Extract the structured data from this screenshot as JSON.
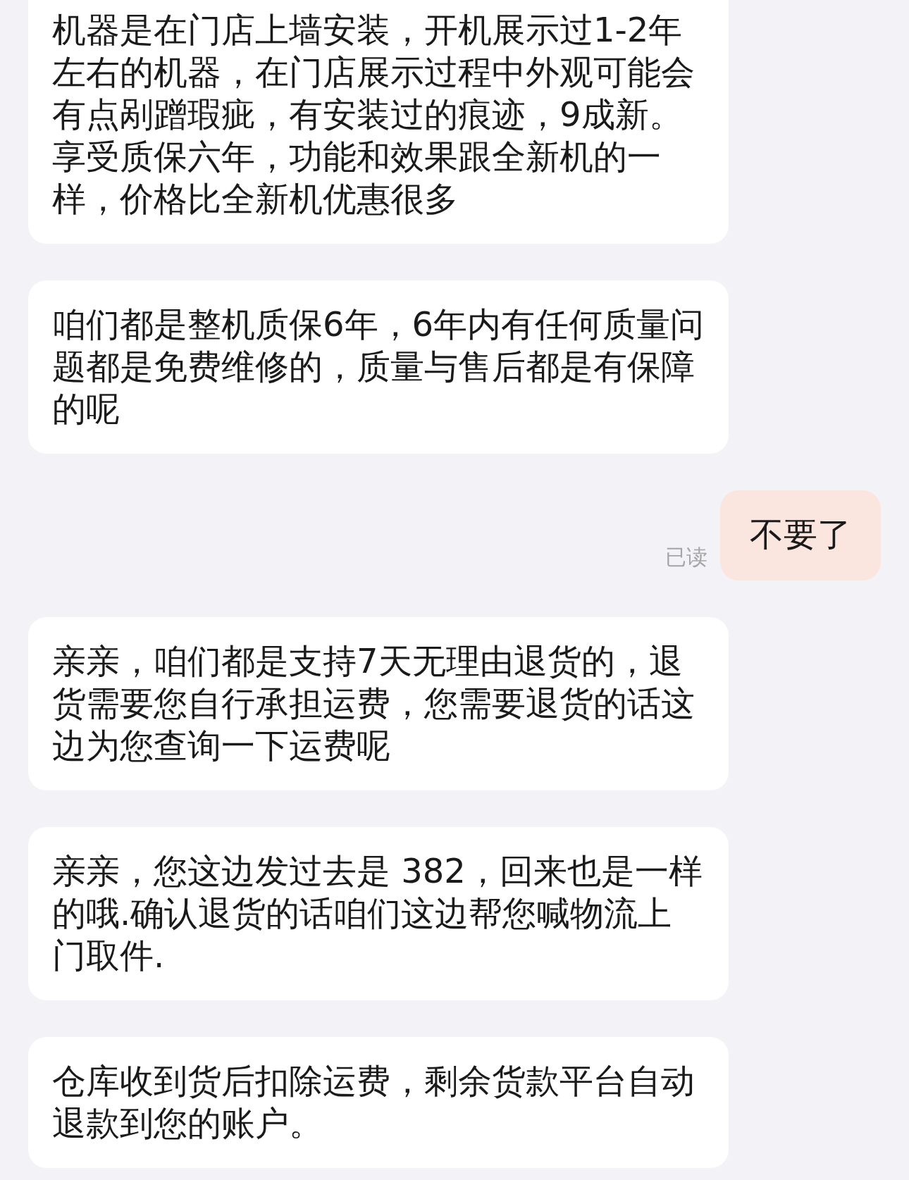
{
  "messages": [
    {
      "kind": "received",
      "text": "机器是在门店上墙安装，开机展示过1-2年左右的机器，在门店展示过程中外观可能会有点剐蹭瑕疵，有安装过的痕迹，9成新。享受质保六年，功能和效果跟全新机的一样，价格比全新机优惠很多"
    },
    {
      "kind": "received",
      "text": "咱们都是整机质保6年，6年内有任何质量问题都是免费维修的，质量与售后都是有保障的呢"
    },
    {
      "kind": "sent",
      "text": "不要了",
      "status": "已读"
    },
    {
      "kind": "received",
      "text": "亲亲，咱们都是支持7天无理由退货的，退货需要您自行承担运费，您需要退货的话这边为您查询一下运费呢"
    },
    {
      "kind": "received",
      "text": "亲亲，您这边发过去是 382，回来也是一样的哦.确认退货的话咱们这边帮您喊物流上门取件."
    },
    {
      "kind": "received",
      "text": "仓库收到货后扣除运费，剩余货款平台自动退款到您的账户。"
    }
  ]
}
